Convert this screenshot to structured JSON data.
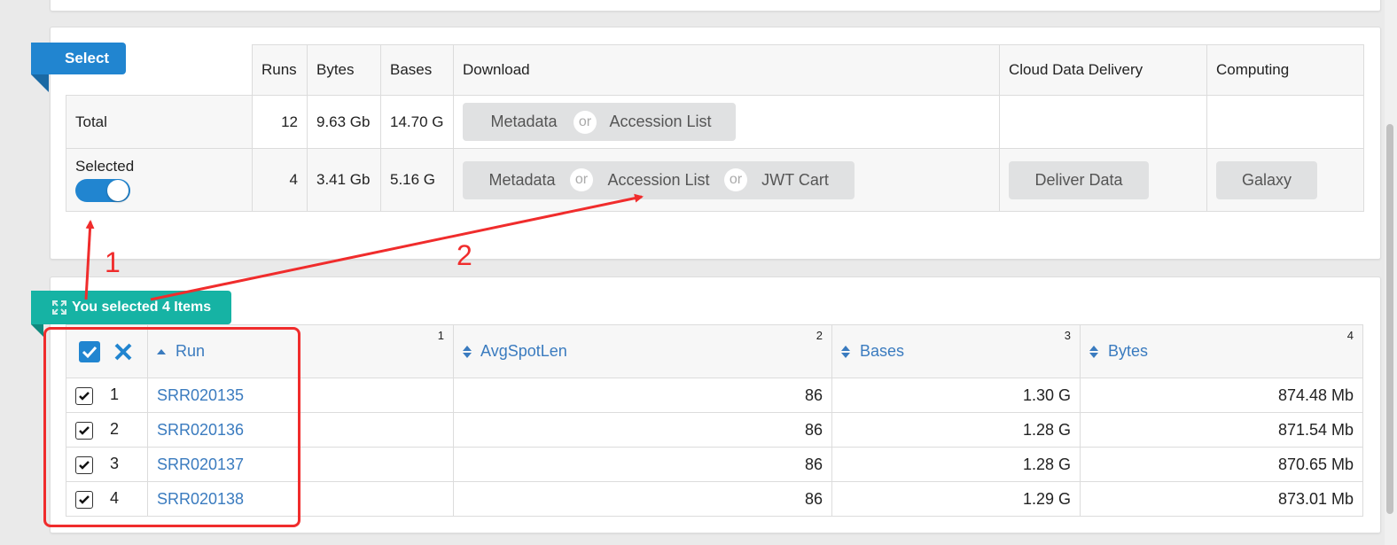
{
  "select_panel": {
    "ribbon_label": "Select",
    "headers": {
      "runs": "Runs",
      "bytes": "Bytes",
      "bases": "Bases",
      "download": "Download",
      "cloud": "Cloud Data Delivery",
      "computing": "Computing"
    },
    "total_row": {
      "label": "Total",
      "runs": "12",
      "bytes": "9.63 Gb",
      "bases": "14.70 G",
      "metadata": "Metadata",
      "or1": "or",
      "accession_list": "Accession List"
    },
    "selected_row": {
      "label": "Selected",
      "toggle_on": true,
      "runs": "4",
      "bytes": "3.41 Gb",
      "bases": "5.16 G",
      "metadata": "Metadata",
      "or1": "or",
      "accession_list": "Accession List",
      "or2": "or",
      "jwt_cart": "JWT Cart",
      "deliver_data": "Deliver Data",
      "galaxy": "Galaxy"
    }
  },
  "runs_panel": {
    "ribbon_label": "You selected 4 Items",
    "columns": [
      {
        "label": "Run",
        "num": "1"
      },
      {
        "label": "AvgSpotLen",
        "num": "2"
      },
      {
        "label": "Bases",
        "num": "3"
      },
      {
        "label": "Bytes",
        "num": "4"
      }
    ],
    "rows": [
      {
        "index": "1",
        "run": "SRR020135",
        "avgspotlen": "86",
        "bases": "1.30 G",
        "bytes": "874.48 Mb"
      },
      {
        "index": "2",
        "run": "SRR020136",
        "avgspotlen": "86",
        "bases": "1.28 G",
        "bytes": "871.54 Mb"
      },
      {
        "index": "3",
        "run": "SRR020137",
        "avgspotlen": "86",
        "bases": "1.28 G",
        "bytes": "870.65 Mb"
      },
      {
        "index": "4",
        "run": "SRR020138",
        "avgspotlen": "86",
        "bases": "1.29 G",
        "bytes": "873.01 Mb"
      }
    ]
  },
  "annotations": {
    "label_1": "1",
    "label_2": "2",
    "color": "#f02c2c"
  },
  "colors": {
    "primary_blue": "#2185d0",
    "teal": "#16b3a4",
    "link_blue": "#3a7bbf",
    "button_gray": "#e0e1e2"
  }
}
